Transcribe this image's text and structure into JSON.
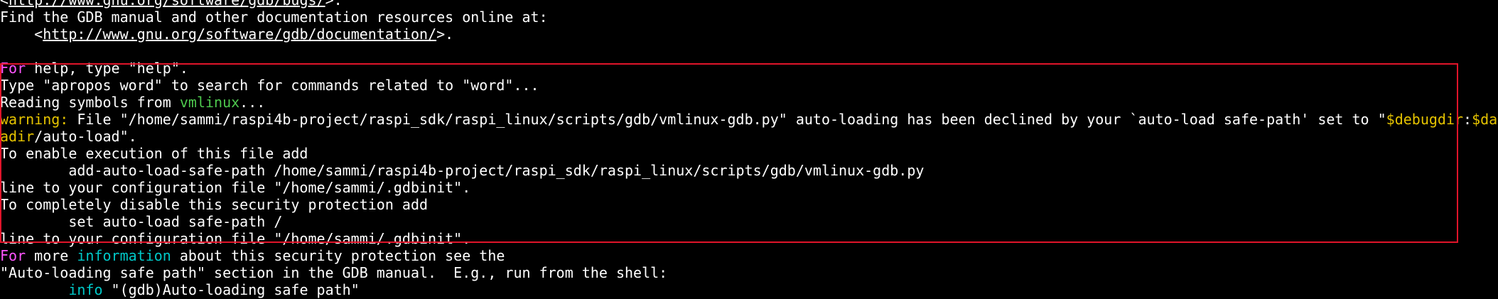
{
  "colors": {
    "background": "#000000",
    "text": "#ffffff",
    "magenta": "#ff55ff",
    "cyan": "#00c8c8",
    "green": "#4ec94e",
    "yellow": "#e5c300",
    "annotation_box": "#e0142a"
  },
  "lines": {
    "l0": {
      "pre": "<",
      "link": "http://www.gnu.org/software/gdb/bugs/",
      "post": ">."
    },
    "l1": {
      "text": "Find the GDB manual and other documentation resources online at:"
    },
    "l2": {
      "pre": "    <",
      "link": "http://www.gnu.org/software/gdb/documentation/",
      "post": ">."
    },
    "l3": {
      "kw": "For",
      "rest": " help, type \"help\"."
    },
    "l4": {
      "text": "Type \"apropos word\" to search for commands related to \"word\"..."
    },
    "l5": {
      "pre": "Reading symbols from ",
      "file": "vmlinux",
      "post": "..."
    },
    "l6": {
      "kw": "warning:",
      "mid": " File \"/home/sammi/raspi4b-project/raspi_sdk/raspi_linux/scripts/gdb/vmlinux-gdb.py\" auto-loading has been declined by your `auto-load safe-path' set to \"",
      "var1": "$debugdir",
      "sep": ":",
      "var2": "$dat"
    },
    "l7": {
      "var": "adir",
      "rest": "/auto-load\"."
    },
    "l8": {
      "text": "To enable execution of this file add"
    },
    "l9": {
      "text": "        add-auto-load-safe-path /home/sammi/raspi4b-project/raspi_sdk/raspi_linux/scripts/gdb/vmlinux-gdb.py"
    },
    "l10": {
      "text": "line to your configuration file \"/home/sammi/.gdbinit\"."
    },
    "l11": {
      "text": "To completely disable this security protection add"
    },
    "l12": {
      "text": "        set auto-load safe-path /"
    },
    "l13": {
      "text": "line to your configuration file \"/home/sammi/.gdbinit\"."
    },
    "l14": {
      "kw": "For",
      "mid": " more ",
      "kw2": "information",
      "rest": " about this security protection see the"
    },
    "l15": {
      "text": "\"Auto-loading safe path\" section in the GDB manual.  E.g., run from the shell:"
    },
    "l16": {
      "indent": "        ",
      "kw": "info",
      "rest": " \"(gdb)Auto-loading safe path\""
    }
  }
}
